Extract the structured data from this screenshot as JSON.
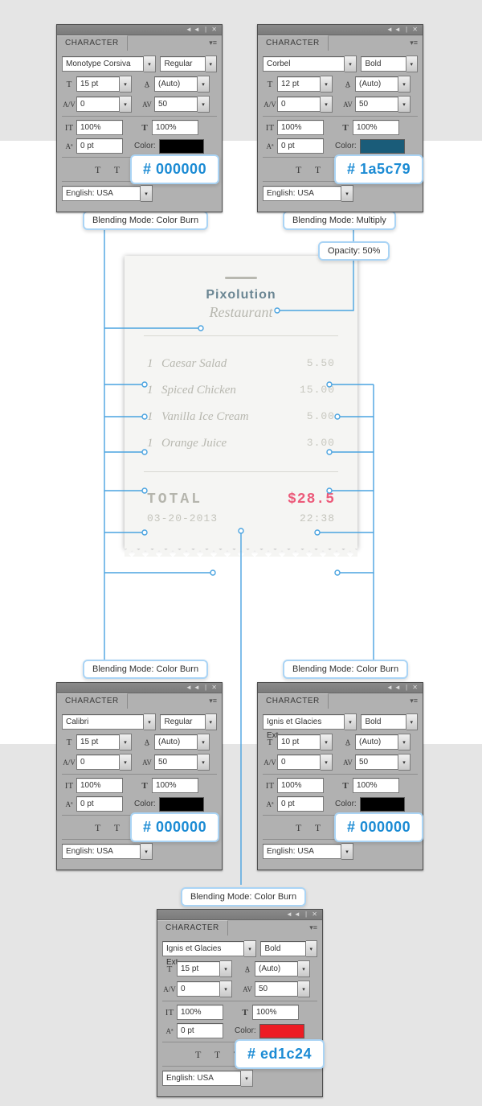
{
  "panels": {
    "p1": {
      "title": "CHARACTER",
      "font": "Monotype Corsiva",
      "style": "Regular",
      "size": "15 pt",
      "leading": "(Auto)",
      "kerning": "0",
      "tracking": "50",
      "vscale": "100%",
      "hscale": "100%",
      "baseline": "0 pt",
      "color_label": "Color:",
      "color": "#000000",
      "language": "English: USA",
      "hex_callout": "# 000000",
      "hex_color": "#1b8bd4"
    },
    "p2": {
      "title": "CHARACTER",
      "font": "Corbel",
      "style": "Bold",
      "size": "12 pt",
      "leading": "(Auto)",
      "kerning": "0",
      "tracking": "50",
      "vscale": "100%",
      "hscale": "100%",
      "baseline": "0 pt",
      "color_label": "Color:",
      "color": "#1a5c79",
      "language": "English: USA",
      "hex_callout": "# 1a5c79",
      "hex_color": "#1b8bd4"
    },
    "p3": {
      "title": "CHARACTER",
      "font": "Calibri",
      "style": "Regular",
      "size": "15 pt",
      "leading": "(Auto)",
      "kerning": "0",
      "tracking": "50",
      "vscale": "100%",
      "hscale": "100%",
      "baseline": "0 pt",
      "color_label": "Color:",
      "color": "#000000",
      "language": "English: USA",
      "hex_callout": "# 000000",
      "hex_color": "#1b8bd4"
    },
    "p4": {
      "title": "CHARACTER",
      "font": "Ignis et Glacies Ext...",
      "style": "Bold",
      "size": "10 pt",
      "leading": "(Auto)",
      "kerning": "0",
      "tracking": "50",
      "vscale": "100%",
      "hscale": "100%",
      "baseline": "0 pt",
      "color_label": "Color:",
      "color": "#000000",
      "language": "English: USA",
      "hex_callout": "# 000000",
      "hex_color": "#1b8bd4"
    },
    "p5": {
      "title": "CHARACTER",
      "font": "Ignis et Glacies Ext...",
      "style": "Bold",
      "size": "15 pt",
      "leading": "(Auto)",
      "kerning": "0",
      "tracking": "50",
      "vscale": "100%",
      "hscale": "100%",
      "baseline": "0 pt",
      "color_label": "Color:",
      "color": "#ed1c24",
      "language": "English: USA",
      "hex_callout": "# ed1c24",
      "hex_color": "#1b8bd4"
    }
  },
  "callouts": {
    "c1": "Blending Mode: Color Burn",
    "c2": "Blending Mode: Multiply",
    "c3": "Opacity: 50%",
    "c4": "Blending Mode: Color Burn",
    "c5": "Blending Mode: Color Burn",
    "c6": "Blending Mode: Color Burn"
  },
  "receipt": {
    "title1": "Pixolution",
    "title2": "Restaurant",
    "items": [
      {
        "qty": "1",
        "name": "Caesar Salad",
        "price": "5.50"
      },
      {
        "qty": "1",
        "name": "Spiced Chicken",
        "price": "15.00"
      },
      {
        "qty": "1",
        "name": "Vanilla Ice Cream",
        "price": "5.00"
      },
      {
        "qty": "1",
        "name": "Orange Juice",
        "price": "3.00"
      }
    ],
    "total_label": "TOTAL",
    "total_value": "$28.5",
    "date": "03-20-2013",
    "time": "22:38"
  },
  "tt_icons": "T  T  TT Tr"
}
